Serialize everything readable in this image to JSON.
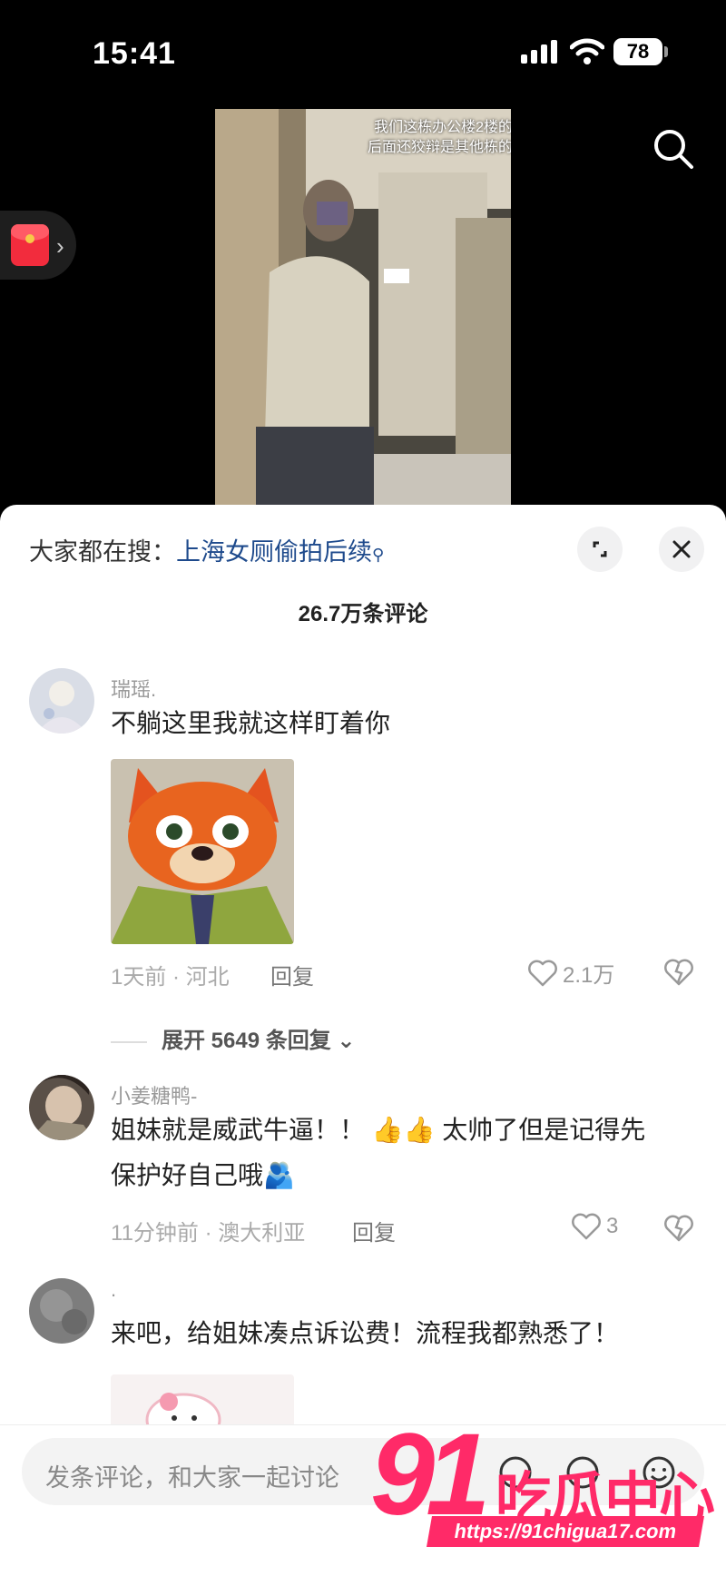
{
  "status_bar": {
    "time": "15:41",
    "battery": "78"
  },
  "video": {
    "overlay_line1": "我们这栋办公楼2楼的",
    "overlay_line2": "后面还狡辩是其他栋的"
  },
  "panel": {
    "search_prefix": "大家都在搜：",
    "search_keyword": "上海女厕偷拍后续",
    "comment_count": "26.7万条评论"
  },
  "comments": [
    {
      "name": "瑞瑶.",
      "text": "不躺这里我就这样盯着你",
      "time_location": "1天前 · 河北",
      "reply": "回复",
      "likes": "2.1万",
      "expand": "展开 5649 条回复"
    },
    {
      "name": "小姜糖鸭-",
      "text_line1": "姐妹就是威武牛逼！！ 👍👍 太帅了但是记得先",
      "text_line2": "保护好自己哦🫂",
      "time_location": "11分钟前 · 澳大利亚",
      "reply": "回复",
      "likes": "3"
    },
    {
      "name": ".",
      "text": "来吧，给姐妹凑点诉讼费！流程我都熟悉了！"
    }
  ],
  "comment_input": {
    "placeholder": "发条评论，和大家一起讨论"
  },
  "watermark": {
    "brand_number": "91",
    "brand_text": "吃瓜中心",
    "url": "https://91chigua17.com"
  },
  "colors": {
    "keyword_blue": "#1e4a8c",
    "watermark_pink": "#ff2a68",
    "red_packet": "#f22c3d"
  }
}
